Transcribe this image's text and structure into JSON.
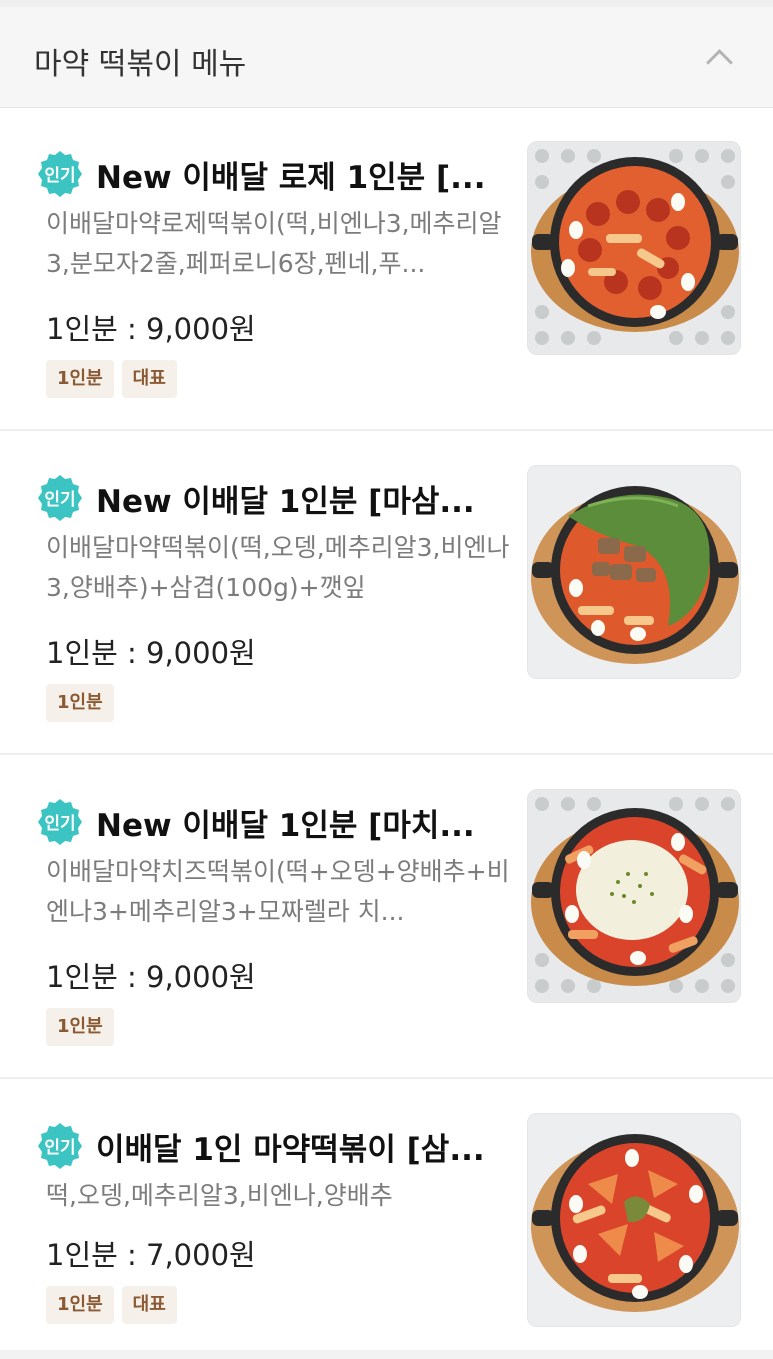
{
  "section": {
    "title": "마약 떡볶이 메뉴"
  },
  "items": [
    {
      "badge": "인기",
      "title": "New 이배달 로제 1인분 [...",
      "description": "이배달마약로제떡볶이(떡,비엔나3,메추리알3,분모자2줄,페퍼로니6장,펜네,푸...",
      "price": "1인분 : 9,000원",
      "tags": [
        "1인분",
        "대표"
      ],
      "image": "rose-tteokbokki-photo"
    },
    {
      "badge": "인기",
      "title": "New 이배달 1인분 [마삼...",
      "description": "이배달마약떡볶이(떡,오뎅,메추리알3,비엔나3,양배추)+삼겹(100g)+깻잎",
      "price": "1인분 : 9,000원",
      "tags": [
        "1인분"
      ],
      "image": "pork-belly-tteokbokki-photo"
    },
    {
      "badge": "인기",
      "title": "New 이배달 1인분 [마치...",
      "description": "이배달마약치즈떡볶이(떡+오뎅+양배추+비엔나3+메추리알3+모짜렐라 치...",
      "price": "1인분 : 9,000원",
      "tags": [
        "1인분"
      ],
      "image": "cheese-tteokbokki-photo"
    },
    {
      "badge": "인기",
      "title": "이배달 1인 마약떡볶이 [삼...",
      "description": "떡,오뎅,메추리알3,비엔나,양배추",
      "price": "1인분 : 7,000원",
      "tags": [
        "1인분",
        "대표"
      ],
      "image": "classic-tteokbokki-photo"
    }
  ],
  "colors": {
    "badge": "#3cc4c3",
    "tag_bg": "#f5f0ea",
    "tag_text": "#8b5a32",
    "sauce": "#d9442b",
    "pan": "#2b2b2b",
    "board": "#c98b4a"
  }
}
